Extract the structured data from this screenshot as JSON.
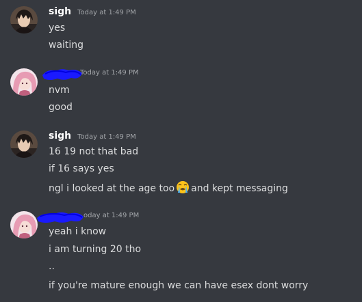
{
  "colors": {
    "background": "#36393f",
    "text": "#dcddde",
    "username": "#ffffff",
    "timestamp": "#a3a6aa",
    "redaction": "#1a1aff"
  },
  "messages": [
    {
      "username": "sigh",
      "timestamp": "Today at 1:49 PM",
      "avatar": "dark-hair-anime-avatar",
      "lines": [
        "yes",
        "waiting"
      ]
    },
    {
      "username": "",
      "username_redacted": true,
      "timestamp": "Today at 1:49 PM",
      "avatar": "pink-hair-anime-avatar",
      "lines": [
        "nvm",
        "good"
      ]
    },
    {
      "username": "sigh",
      "timestamp": "Today at 1:49 PM",
      "avatar": "dark-hair-anime-avatar",
      "lines": [
        "16 19 not that bad",
        "if 16 says yes",
        "ngl i looked at the age too",
        "and kept messaging"
      ],
      "emoji": "loudly-crying-face"
    },
    {
      "username": "",
      "username_redacted": true,
      "timestamp": "oday at 1:49 PM",
      "avatar": "pink-hair-anime-avatar",
      "lines": [
        "yeah i know",
        "i am turning 20 tho",
        "..",
        "if you're mature enough we can have esex dont worry"
      ]
    }
  ]
}
